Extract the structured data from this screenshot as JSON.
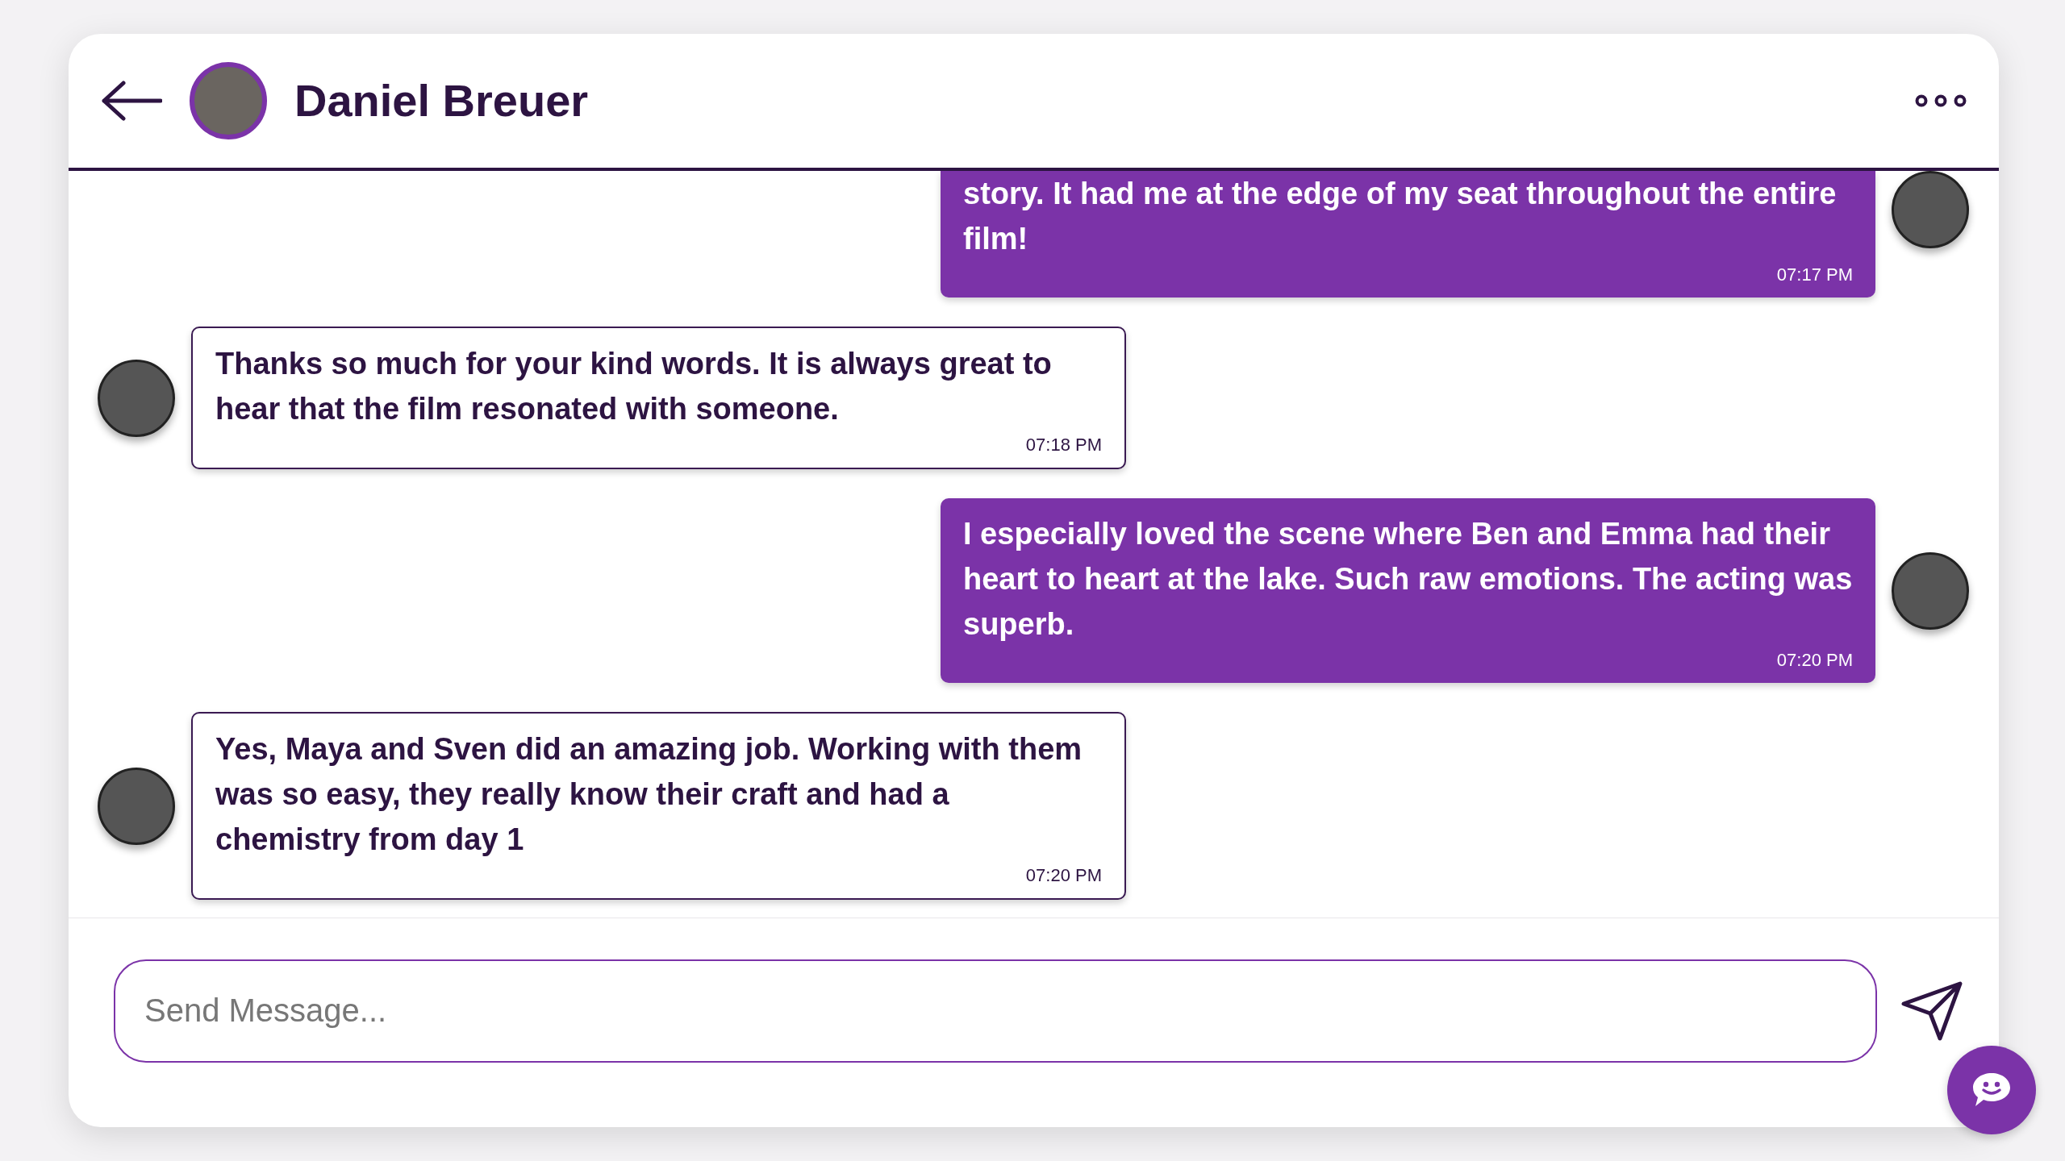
{
  "header": {
    "title": "Daniel Breuer"
  },
  "messages": [
    {
      "kind": "sent",
      "text": "story. It had me at the edge of my seat throughout the entire film!",
      "time": "07:17 PM"
    },
    {
      "kind": "received",
      "text": "Thanks so much for your kind words. It is always great to hear that the film resonated with someone.",
      "time": "07:18 PM"
    },
    {
      "kind": "sent",
      "text": "I especially loved the scene where Ben and Emma had their heart to heart at the lake. Such raw emotions. The acting was superb.",
      "time": "07:20 PM"
    },
    {
      "kind": "received",
      "text": "Yes, Maya and Sven did an amazing job. Working with them was so easy, they really know their craft and had a chemistry from day 1",
      "time": "07:20 PM"
    }
  ],
  "composer": {
    "placeholder": "Send Message..."
  }
}
